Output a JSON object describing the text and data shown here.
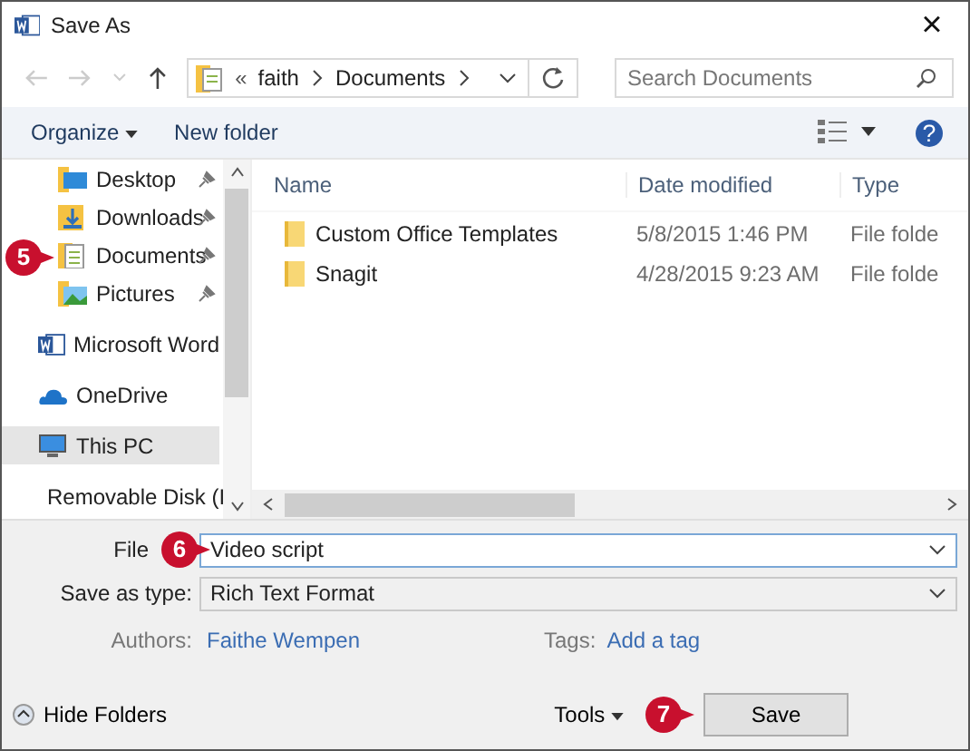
{
  "window": {
    "title": "Save As",
    "close": "×"
  },
  "address": {
    "overflow": "«",
    "path": [
      "faith",
      "Documents"
    ],
    "search_placeholder": "Search Documents"
  },
  "toolbar": {
    "organize": "Organize",
    "new_folder": "New folder",
    "help": "?"
  },
  "sidebar": {
    "items": [
      {
        "label": "Desktop",
        "kind": "desktop",
        "pinned": true,
        "selected": false
      },
      {
        "label": "Downloads",
        "kind": "downloads",
        "pinned": true,
        "selected": false
      },
      {
        "label": "Documents",
        "kind": "documents",
        "pinned": true,
        "selected": false
      },
      {
        "label": "Pictures",
        "kind": "pictures",
        "pinned": true,
        "selected": false
      },
      {
        "label": "Microsoft Word",
        "kind": "word",
        "pinned": false,
        "selected": false
      },
      {
        "label": "OneDrive",
        "kind": "cloud",
        "pinned": false,
        "selected": false
      },
      {
        "label": "This PC",
        "kind": "pc",
        "pinned": false,
        "selected": true
      },
      {
        "label": "Removable Disk (I",
        "kind": "disk",
        "pinned": false,
        "selected": false
      }
    ]
  },
  "table": {
    "columns": [
      "Name",
      "Date modified",
      "Type"
    ],
    "rows": [
      {
        "name": "Custom Office Templates",
        "date": "5/8/2015 1:46 PM",
        "type": "File folde"
      },
      {
        "name": "Snagit",
        "date": "4/28/2015 9:23 AM",
        "type": "File folde"
      }
    ]
  },
  "form": {
    "file_label": "File",
    "file_value": "Video script",
    "type_label": "Save as type:",
    "type_value": "Rich Text Format",
    "authors_label": "Authors:",
    "authors_value": "Faithe Wempen",
    "tags_label": "Tags:",
    "tags_value": "Add a tag"
  },
  "footer": {
    "hide_folders": "Hide Folders",
    "tools": "Tools",
    "save": "Save"
  },
  "callouts": [
    "5",
    "6",
    "7"
  ]
}
